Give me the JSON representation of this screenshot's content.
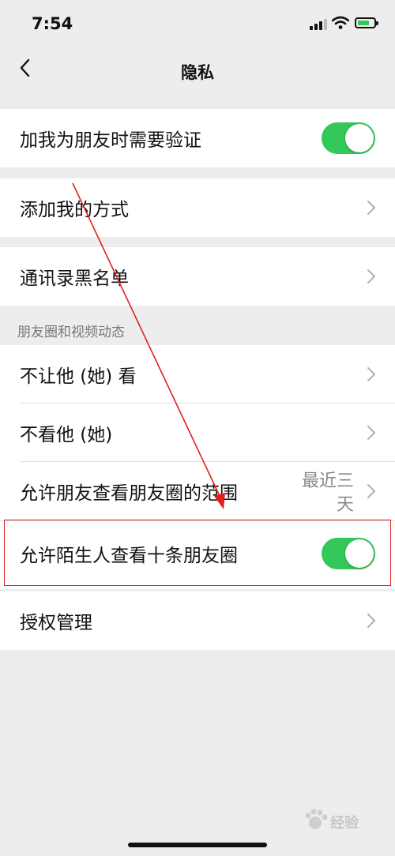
{
  "status_bar": {
    "time": "7:54"
  },
  "nav": {
    "title": "隐私"
  },
  "rows": {
    "verify": {
      "label": "加我为朋友时需要验证",
      "toggle_on": true
    },
    "add_ways": {
      "label": "添加我的方式"
    },
    "blacklist": {
      "label": "通讯录黑名单"
    },
    "moments_section": "朋友圈和视频动态",
    "dont_let_see": {
      "label": "不让他 (她) 看"
    },
    "dont_see": {
      "label": "不看他 (她)"
    },
    "range": {
      "label": "允许朋友查看朋友圈的范围",
      "value": "最近三天"
    },
    "strangers": {
      "label": "允许陌生人查看十条朋友圈",
      "toggle_on": true
    },
    "auth": {
      "label": "授权管理"
    }
  },
  "watermark": {
    "text": "经验"
  },
  "colors": {
    "toggle": "#34c759",
    "annotation": "#e02020",
    "background": "#ededed"
  }
}
